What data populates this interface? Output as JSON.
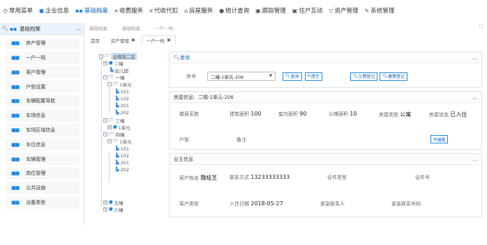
{
  "topnav": {
    "items": [
      {
        "label": "常用菜单",
        "icon": "clock-icon"
      },
      {
        "label": "企业信息",
        "icon": "user-icon"
      },
      {
        "label": "基础档案",
        "icon": "grid-icon"
      },
      {
        "label": "收费服务",
        "icon": "yen-icon"
      },
      {
        "label": "代收代扣",
        "icon": "yen-icon"
      },
      {
        "label": "房屋服务",
        "icon": "home-icon"
      },
      {
        "label": "统计查询",
        "icon": "pin-icon"
      },
      {
        "label": "跟踪管理",
        "icon": "list-icon"
      },
      {
        "label": "住户互动",
        "icon": "chat-icon"
      },
      {
        "label": "资产管理",
        "icon": "cart-icon"
      },
      {
        "label": "系统管理",
        "icon": "wrench-icon"
      }
    ]
  },
  "sidebar": {
    "header": "基础档案",
    "items": [
      "房产管理",
      "一户一档",
      "客户管理",
      "户型设置",
      "车辆配置导航",
      "车场信息",
      "车场区域信息",
      "车位信息",
      "车辆管理",
      "岗位管理",
      "公共设施",
      "设备类型"
    ]
  },
  "breadcrumb": [
    "基础档案",
    "基础档案",
    "一户一档"
  ],
  "tabs": [
    {
      "label": "首页",
      "closable": false
    },
    {
      "label": "房产管理",
      "closable": true
    },
    {
      "label": "一户一档",
      "closable": true
    }
  ],
  "tree": {
    "root": "云翔苑二区",
    "nodes": [
      "二幢",
      "幼儿园",
      "一幢",
      "1单元",
      "101",
      "102",
      "201",
      "202",
      "三幢",
      "1单元",
      "四幢",
      "1单元",
      "101",
      "102",
      "201",
      "202",
      "五幢",
      "六幢"
    ]
  },
  "query": {
    "title": "查询",
    "room_label": "房号",
    "room_value": "二幢-1单元-206",
    "btn_query": "查询",
    "btn_clear": "清空",
    "btn_checkin": "欠费登记",
    "btn_register": "缴费登记"
  },
  "house": {
    "title": "房屋信息：二幢-1单元-206",
    "floor_coef_label": "楼层系数",
    "build_area_label": "建筑面积",
    "build_area": "100",
    "inner_area_label": "套内面积",
    "inner_area": "90",
    "public_area_label": "公摊面积",
    "public_area": "10",
    "type_label": "房屋类型",
    "type_value": "公寓",
    "status_label": "房屋状态",
    "status_value": "已入住",
    "layout_label": "户型",
    "remark_label": "备注",
    "edit_btn": "编辑"
  },
  "owner": {
    "title": "业主信息",
    "name_label": "客户姓名",
    "name_value": "魏桂芝",
    "contact_label": "联系方式",
    "contact_value": "13233333333",
    "id_type_label": "证件类型",
    "id_no_label": "证件号",
    "cust_type_label": "客户类型",
    "checkin_label": "入住日期",
    "checkin_value": "2018-05-27",
    "emergency_label": "紧急联系人",
    "emergency_phone_label": "紧急联系号码"
  }
}
